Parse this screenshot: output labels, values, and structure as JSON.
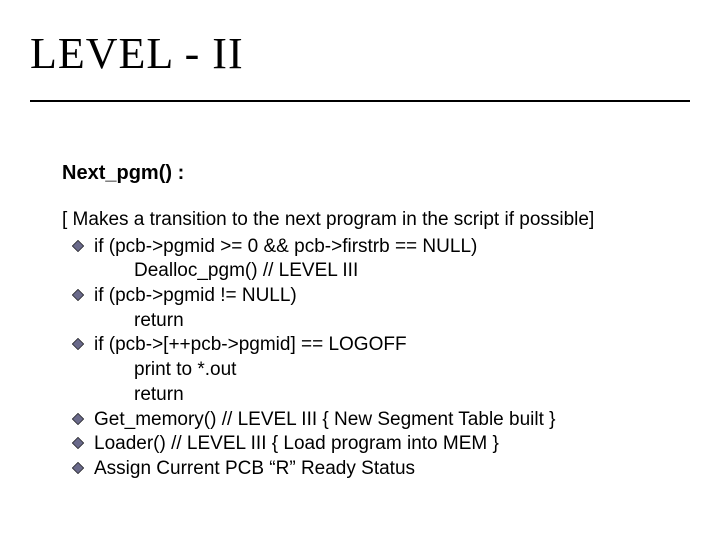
{
  "title": "LEVEL - II",
  "subtitle": "Next_pgm() :",
  "intro": "[ Makes a transition to the next program in the script if possible]",
  "items": [
    {
      "line": "if (pcb->pgmid >= 0 && pcb->firstrb == NULL)",
      "sub": [
        "Dealloc_pgm() // LEVEL III"
      ]
    },
    {
      "line": "if (pcb->pgmid != NULL)",
      "sub": [
        "return"
      ]
    },
    {
      "line": "if (pcb->[++pcb->pgmid] == LOGOFF",
      "sub": [
        "print to *.out",
        "return"
      ]
    },
    {
      "line": "Get_memory()  // LEVEL  III  {  New Segment Table built   }",
      "sub": []
    },
    {
      "line": "Loader()          // LEVEL  III  {   Load program into MEM    }",
      "sub": []
    },
    {
      "line": "Assign Current PCB “R” Ready Status",
      "sub": []
    }
  ]
}
